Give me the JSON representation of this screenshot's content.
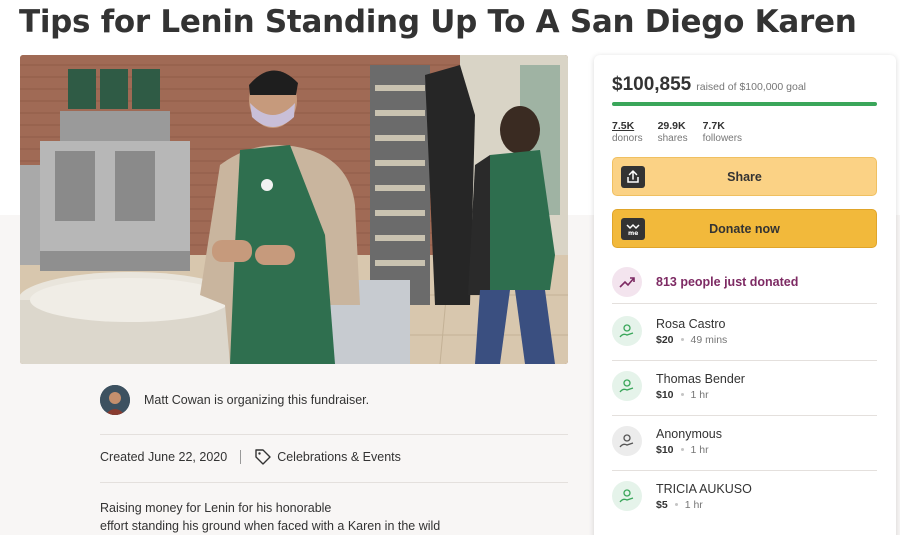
{
  "page": {
    "title": "Tips for Lenin Standing Up To A San Diego Karen"
  },
  "organizer": {
    "text": "Matt Cowan is organizing this fundraiser."
  },
  "meta": {
    "created": "Created June 22, 2020",
    "category": "Celebrations & Events"
  },
  "description": {
    "line1": "Raising money for Lenin for his honorable",
    "line2": "effort standing his ground when faced with a Karen in the wild"
  },
  "campaign": {
    "raised": "$100,855",
    "goal_text": "raised of $100,000 goal",
    "progress_fraction": 1.0,
    "stats": [
      {
        "value": "7.5K",
        "label": "donors"
      },
      {
        "value": "29.9K",
        "label": "shares"
      },
      {
        "value": "7.7K",
        "label": "followers"
      }
    ],
    "share_label": "Share",
    "donate_label": "Donate now",
    "recent_label": "813 people just donated",
    "donations": [
      {
        "name": "Rosa Castro",
        "amount": "$20",
        "time": "49 mins"
      },
      {
        "name": "Thomas Bender",
        "amount": "$10",
        "time": "1 hr"
      },
      {
        "name": "Anonymous",
        "amount": "$10",
        "time": "1 hr"
      },
      {
        "name": "TRICIA AUKUSO",
        "amount": "$5",
        "time": "1 hr"
      }
    ]
  },
  "colors": {
    "progress": "#3aa65a",
    "share_button": "#fbd285",
    "donate_button": "#f2b93b",
    "recent_text": "#7d2a63"
  },
  "icons": {
    "share": "share-upload-icon",
    "donate": "donate-icon",
    "trend": "trending-up-icon",
    "donor": "donor-hand-icon",
    "category": "tag-icon"
  }
}
